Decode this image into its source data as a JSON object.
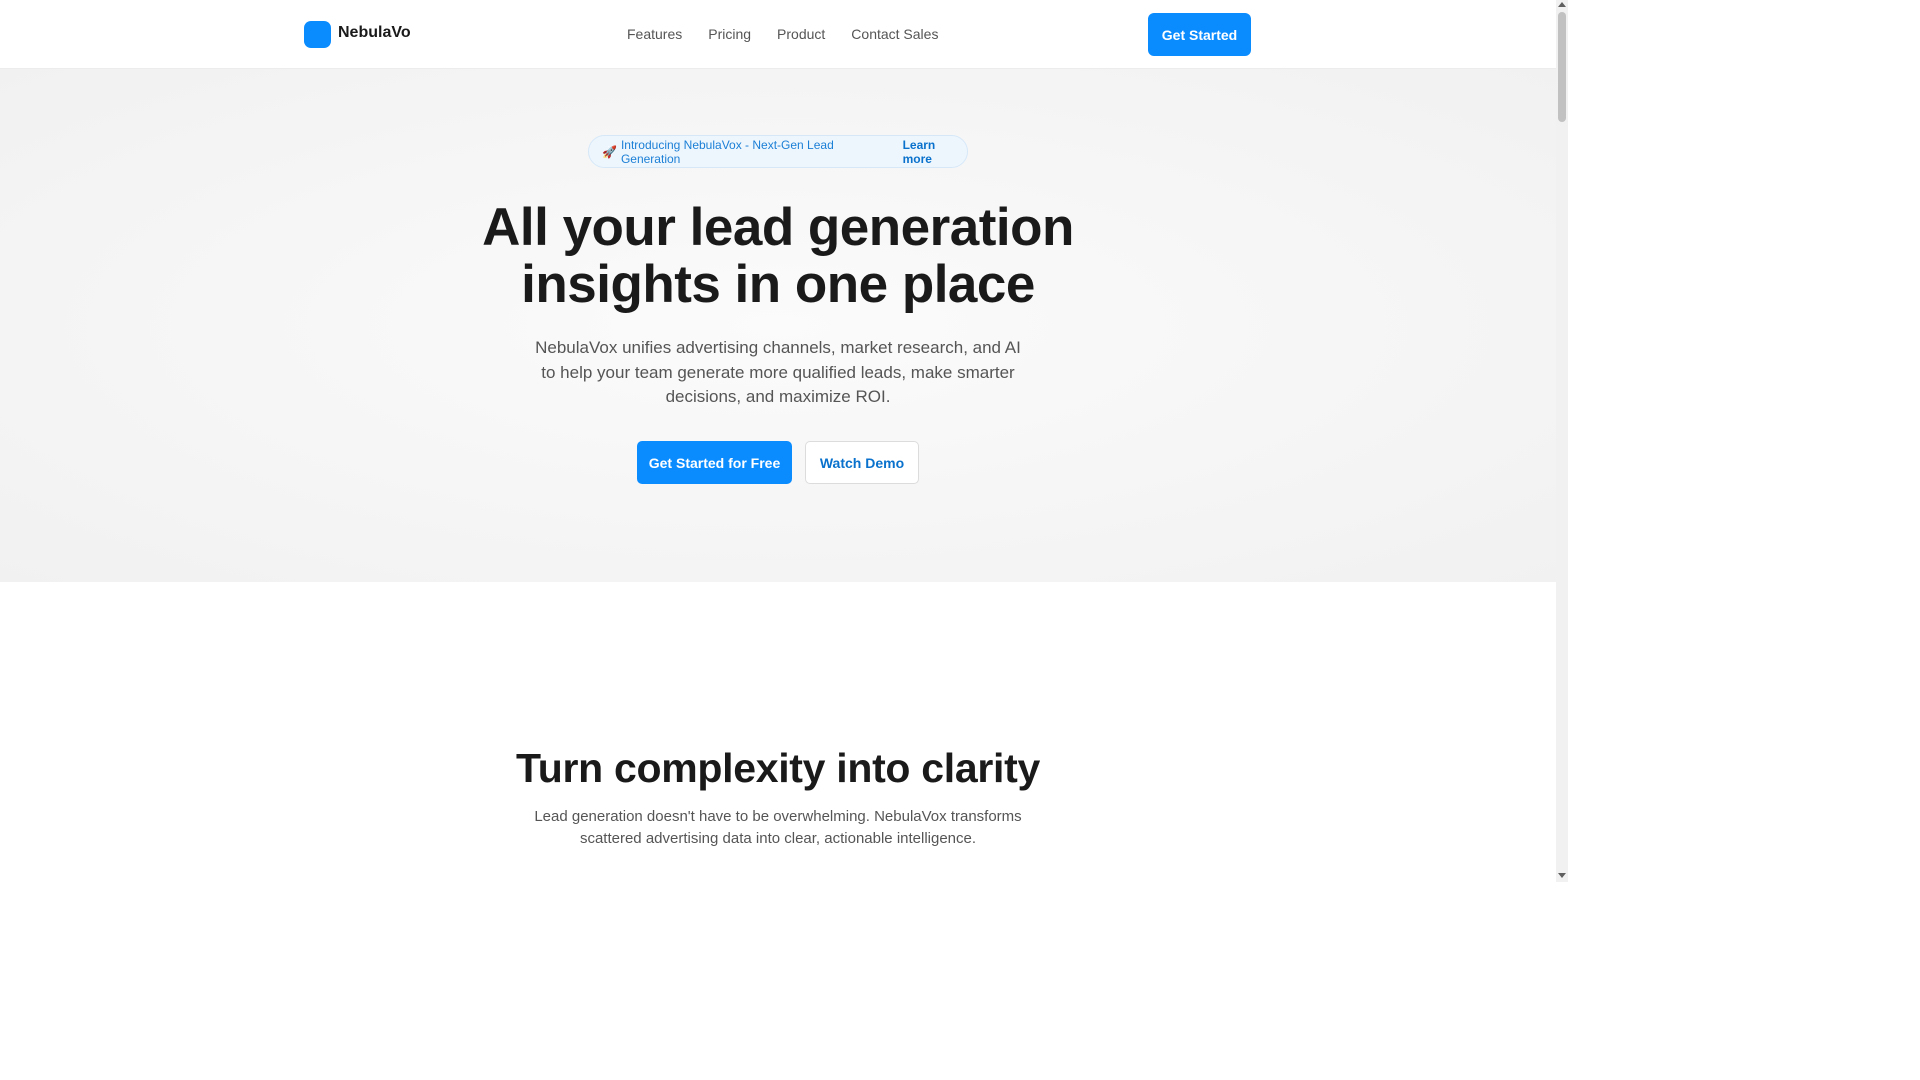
{
  "nav": {
    "brand_name": "NebulaVo",
    "brand_icon": "logo-square-icon",
    "links": [
      {
        "label": "Features"
      },
      {
        "label": "Pricing"
      },
      {
        "label": "Product"
      },
      {
        "label": "Contact Sales"
      }
    ],
    "cta_label": "Get Started"
  },
  "hero": {
    "announcement": {
      "icon": "rocket-icon",
      "icon_glyph": "🚀",
      "text": "Introducing NebulaVox - Next-Gen Lead Generation",
      "link_label": "Learn more"
    },
    "title_line1": "All your lead generation",
    "title_line2": "insights in one place",
    "subtitle": "NebulaVox unifies advertising channels, market research, and AI to help your team generate more qualified leads, make smarter decisions, and maximize ROI.",
    "primary_button": "Get Started for Free",
    "secondary_button": "Watch Demo"
  },
  "section2": {
    "title": "Turn complexity into clarity",
    "subtitle": "Lead generation doesn't have to be overwhelming. NebulaVox transforms scattered advertising data into clear, actionable intelligence."
  },
  "colors": {
    "accent": "#0a8cff",
    "link": "#0a72cc",
    "text": "#1a1a1a",
    "muted": "#555555"
  }
}
